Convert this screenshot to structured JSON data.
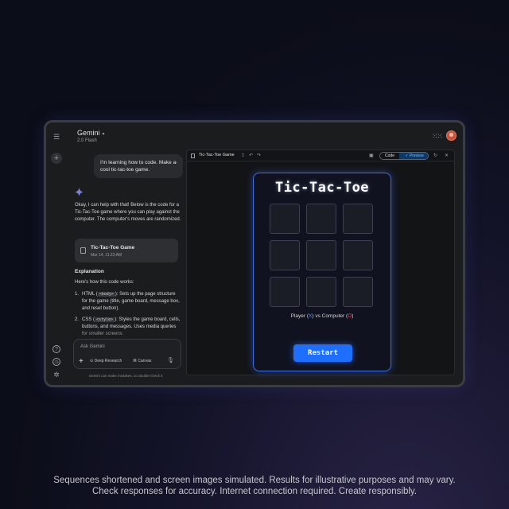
{
  "app": {
    "title": "Gemini",
    "caret": "▾",
    "model": "2.0 Flash"
  },
  "rail": {
    "menu_icon": "menu-icon",
    "new_chat_icon": "plus-icon",
    "help_icon": "help-icon",
    "history_icon": "history-icon",
    "settings_icon": "gear-icon"
  },
  "header": {
    "apps_icon": "apps-grid-icon",
    "avatar_icon": "avatar-icon"
  },
  "chat": {
    "user_message": "I'm learning how to code. Make a cool tic-tac-toe game.",
    "reply_text": "Okay, I can help with that! Below is the code for a Tic-Tac-Toe game where you can play against the computer. The computer's moves are randomized.",
    "card_title": "Tic-Tac-Toe Game",
    "card_date": "Mar 14, 11:23 AM",
    "explanation_title": "Explanation",
    "explanation_intro": "Here's how this code works:",
    "list": [
      {
        "num": "1.",
        "pre": "HTML (",
        "code": "<body>",
        "post": "): Sets up the page structure for the game (title, game board, message box, and reset button)."
      },
      {
        "num": "2.",
        "pre": "CSS (",
        "code": "<style>",
        "post": "): Styles the game board, cells, buttons, and messages. Uses media queries for smaller screens."
      }
    ]
  },
  "input": {
    "placeholder": "Ask Gemini",
    "deep_research": "Deep Research",
    "canvas": "Canvas",
    "disclaimer": "Gemini can make mistakes, so double-check it"
  },
  "canvas_toolbar": {
    "title": "Tic-Tac-Toe Game",
    "code_label": "Code",
    "preview_label": "Preview",
    "preview_check": "✓"
  },
  "game": {
    "title": "Tic-Tac-Toe",
    "status_pre": "Player (",
    "player_symbol": "X",
    "status_mid": ") vs Computer (",
    "computer_symbol": "O",
    "status_post": ")",
    "restart_label": "Restart",
    "cells": [
      "",
      "",
      "",
      "",
      "",
      "",
      "",
      "",
      ""
    ]
  },
  "footer": {
    "line1": "Sequences shortened and screen images simulated. Results for illustrative purposes and may vary.",
    "line2": "Check responses for accuracy. Internet connection required. Create responsibly."
  },
  "colors": {
    "accent_blue": "#1f6fff",
    "player_blue": "#5b8cff",
    "computer_pink": "#ff4d7a"
  }
}
